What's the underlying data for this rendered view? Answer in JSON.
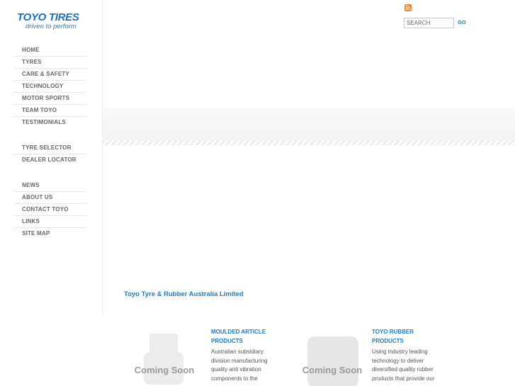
{
  "logo": {
    "brand": "TOYO TIRES",
    "tagline": "driven to perform"
  },
  "nav": {
    "group1": [
      "HOME",
      "TYRES",
      "CARE & SAFETY",
      "TECHNOLOGY",
      "MOTOR SPORTS",
      "TEAM TOYO",
      "TESTIMONIALS"
    ],
    "group2": [
      "TYRE SELECTOR",
      "DEALER LOCATOR"
    ],
    "group3": [
      "NEWS",
      "ABOUT US",
      "CONTACT TOYO",
      "LINKS",
      "SITE MAP"
    ]
  },
  "search": {
    "placeholder": "SEARCH",
    "go_label": "GO"
  },
  "icons": {
    "feed": "rss-icon"
  },
  "colors": {
    "brand_blue": "#1f7bc4",
    "rss_orange": "#f37b21"
  },
  "main": {
    "company_name": "Toyo Tyre & Rubber Australia Limited",
    "products": [
      {
        "image_label": "Coming Soon",
        "title_line1": "MOULDED ARTICLE",
        "title_line2": "PRODUCTS",
        "desc_lines": [
          "Australian subsidiary",
          "division manufacturing",
          "quality anti vibration",
          "components to the"
        ]
      },
      {
        "image_label": "Coming Soon",
        "title_line1": "TOYO RUBBER",
        "title_line2": "PRODUCTS",
        "desc_lines": [
          "Using industry leading",
          "technology to deliver",
          "diversified quality rubber",
          "products that provide our"
        ]
      }
    ]
  }
}
